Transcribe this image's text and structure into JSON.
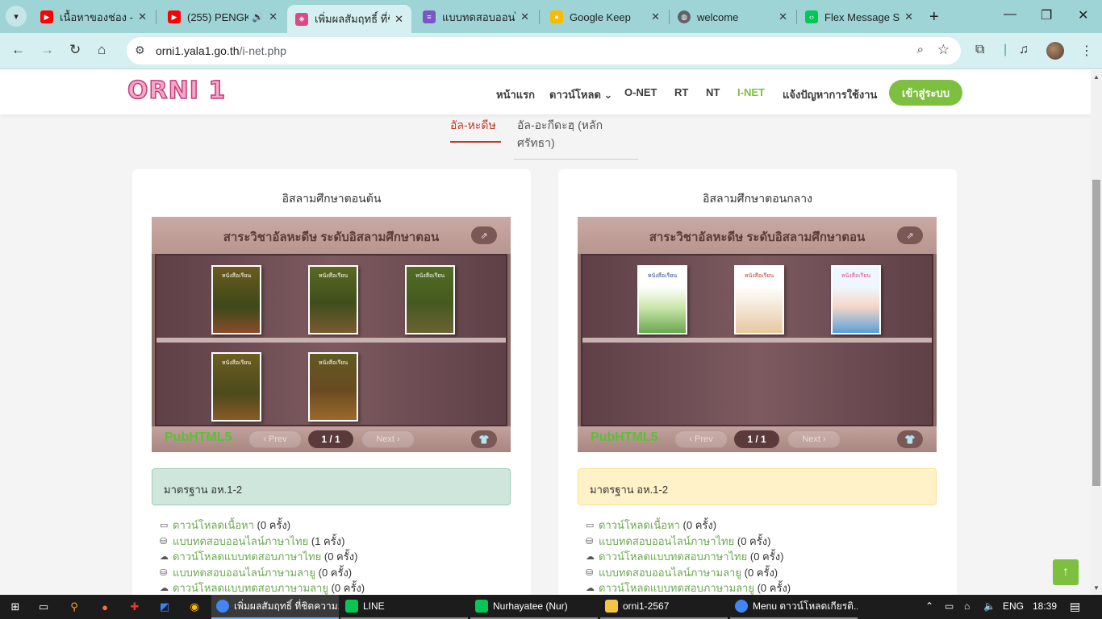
{
  "browser": {
    "tabs": [
      {
        "title": "เนื้อหาของช่อง - Yo",
        "favicon": "youtube-icon",
        "color": "#ff0000"
      },
      {
        "title": "(255) PENGK",
        "favicon": "youtube-icon",
        "color": "#ff0000",
        "audio": "speaker-icon"
      },
      {
        "title": "เพิ่มผลสัมฤทธิ์ ที่ชิด",
        "favicon": "pubhtml-icon",
        "color": "#d84a8a",
        "active": true
      },
      {
        "title": "แบบทดสอบออนไลน์",
        "favicon": "google-forms-icon",
        "color": "#7b57c4"
      },
      {
        "title": "Google Keep",
        "favicon": "keep-icon",
        "color": "#f9bb00"
      },
      {
        "title": "welcome",
        "favicon": "globe-icon",
        "color": "#5f6368"
      },
      {
        "title": "Flex Message Sir",
        "favicon": "line-dev-icon",
        "color": "#06c755"
      }
    ],
    "url_host": "orni1.yala1.go.th",
    "url_path": "/i-net.php"
  },
  "site": {
    "logo": "ORNI 1",
    "menu": [
      {
        "label": "หน้าแรก"
      },
      {
        "label": "ดาวน์โหลด ⌄"
      },
      {
        "label": "O-NET"
      },
      {
        "label": "RT"
      },
      {
        "label": "NT"
      },
      {
        "label": "I-NET",
        "active": true
      },
      {
        "label": "แจ้งปัญหาการใช้งาน"
      }
    ],
    "login_label": "เข้าสู่ระบบ",
    "subtabs": [
      {
        "label": "อัล-หะดีษ",
        "active": true
      },
      {
        "label": "อัล-อะกีดะฮฺ (หลักศรัทธา)"
      }
    ]
  },
  "cards": [
    {
      "title": "อิสลามศึกษาตอนต้น",
      "shelf_title": "สาระวิชาอัลหะดีษ ระดับอิสลามศึกษาตอน",
      "books_row1": 3,
      "books_row2": 2,
      "book_style": "green",
      "pub_logo": "PubHTML5",
      "prev_label": "‹ Prev",
      "next_label": "Next ›",
      "page_indicator": "1 / 1",
      "standard": "มาตรฐาน อห.1-2",
      "standard_color": "green",
      "links": [
        {
          "icon": "book-icon",
          "label": "ดาวน์โหลดเนื้อหา",
          "count": "(0 ครั้ง)"
        },
        {
          "icon": "database-icon",
          "label": "แบบทดสอบออนไลน์ภาษาไทย",
          "count": "(1 ครั้ง)"
        },
        {
          "icon": "cloud-download-icon",
          "label": "ดาวน์โหลดแบบทดสอบภาษาไทย",
          "count": "(0 ครั้ง)"
        },
        {
          "icon": "database-icon",
          "label": "แบบทดสอบออนไลน์ภาษามลายู",
          "count": "(0 ครั้ง)"
        },
        {
          "icon": "cloud-download-icon",
          "label": "ดาวน์โหลดแบบทดสอบภาษามลายู",
          "count": "(0 ครั้ง)"
        }
      ]
    },
    {
      "title": "อิสลามศึกษาตอนกลาง",
      "shelf_title": "สาระวิชาอัลหะดีษ ระดับอิสลามศึกษาตอน",
      "books_row1": 3,
      "books_row2": 0,
      "book_style": "white",
      "pub_logo": "PubHTML5",
      "prev_label": "‹ Prev",
      "next_label": "Next ›",
      "page_indicator": "1 / 1",
      "standard": "มาตรฐาน อห.1-2",
      "standard_color": "yellow",
      "links": [
        {
          "icon": "book-icon",
          "label": "ดาวน์โหลดเนื้อหา",
          "count": "(0 ครั้ง)"
        },
        {
          "icon": "database-icon",
          "label": "แบบทดสอบออนไลน์ภาษาไทย",
          "count": "(0 ครั้ง)"
        },
        {
          "icon": "cloud-download-icon",
          "label": "ดาวน์โหลดแบบทดสอบภาษาไทย",
          "count": "(0 ครั้ง)"
        },
        {
          "icon": "database-icon",
          "label": "แบบทดสอบออนไลน์ภาษามลายู",
          "count": "(0 ครั้ง)"
        },
        {
          "icon": "cloud-download-icon",
          "label": "ดาวน์โหลดแบบทดสอบภาษามลายู",
          "count": "(0 ครั้ง)"
        }
      ]
    }
  ],
  "taskbar": {
    "items": [
      {
        "label": "เพิ่มผลสัมฤทธิ์ ที่ชิดความ...",
        "icon": "chrome-icon",
        "color": "#4285f4",
        "active": true
      },
      {
        "label": "LINE",
        "icon": "line-icon",
        "color": "#06c755"
      },
      {
        "label": "Nurhayatee (Nur)",
        "icon": "line-icon",
        "color": "#06c755"
      },
      {
        "label": "orni1-2567",
        "icon": "folder-icon",
        "color": "#f4c542"
      },
      {
        "label": "Menu ดาวน์โหลดเกียรติ...",
        "icon": "chrome-icon",
        "color": "#4285f4"
      }
    ],
    "lang": "ENG",
    "time": "18:39"
  }
}
